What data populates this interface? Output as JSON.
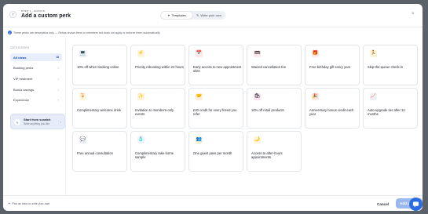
{
  "header": {
    "back_icon": "arrow-left-icon",
    "step": "STEP 1 · BASICS",
    "title": "Add a custom perk",
    "toggle": [
      {
        "label": "Templates",
        "icon": "sparkle-icon",
        "active": true
      },
      {
        "label": "Write your own",
        "icon": "pencil-icon",
        "active": false
      }
    ],
    "close_icon": "close-icon"
  },
  "notice": "These perks are descriptive only — Rebas shows them to members but does not apply or enforce them automatically.",
  "sidebar": {
    "heading": "CATEGORIES",
    "items": [
      {
        "label": "All ideas",
        "badge": "18",
        "active": true
      },
      {
        "label": "Booking perks",
        "badge": "",
        "active": false
      },
      {
        "label": "VIP treatment",
        "badge": "",
        "active": false
      },
      {
        "label": "Bonus savings",
        "badge": "",
        "active": false
      },
      {
        "label": "Experience",
        "badge": "",
        "active": false
      }
    ],
    "scratch": {
      "title": "Start from scratch",
      "subtitle": "Write anything you like"
    }
  },
  "cards": [
    {
      "label": "10% off when booking online",
      "icon": "laptop-icon",
      "color": "#e9eef6"
    },
    {
      "label": "Priority rebooking within 24 hours",
      "icon": "lightning-icon",
      "color": "#fdf5d9"
    },
    {
      "label": "Early access to new appointment slots",
      "icon": "calendar-icon",
      "color": "#fde6e6"
    },
    {
      "label": "Waived cancellation fee",
      "icon": "ticket-icon",
      "color": "#fde6ec"
    },
    {
      "label": "Free birthday gift every year",
      "icon": "gift-icon",
      "color": "#fde9e1"
    },
    {
      "label": "Skip-the-queue check-in",
      "icon": "running-icon",
      "color": "#fff3d6"
    },
    {
      "label": "Complimentary welcome drink",
      "icon": "drink-icon",
      "color": "#fff6da"
    },
    {
      "label": "Invitation to members-only events",
      "icon": "party-icon",
      "color": "#fff3d6"
    },
    {
      "label": "£20 credit for every friend you refer",
      "icon": "handshake-icon",
      "color": "#fff1d9"
    },
    {
      "label": "10% off retail products",
      "icon": "shopping-bag-icon",
      "color": "#fbe3ef"
    },
    {
      "label": "Anniversary bonus credit each year",
      "icon": "celebration-icon",
      "color": "#fde9e1"
    },
    {
      "label": "Auto-upgrade tier after 12 months",
      "icon": "chart-up-icon",
      "color": "#eef0f4"
    },
    {
      "label": "Free annual consultation",
      "icon": "chat-icon",
      "color": "#e8eef8"
    },
    {
      "label": "Complimentary take-home sample",
      "icon": "bottle-icon",
      "color": "#eef3fb"
    },
    {
      "label": "One guest pass per month",
      "icon": "guests-icon",
      "color": "#fff3d6"
    },
    {
      "label": "Access to after-hours appointments",
      "icon": "moon-icon",
      "color": "#fff6da"
    }
  ],
  "footer": {
    "hint": "Pick an idea or write your own",
    "cancel": "Cancel",
    "add": "Add perk"
  }
}
